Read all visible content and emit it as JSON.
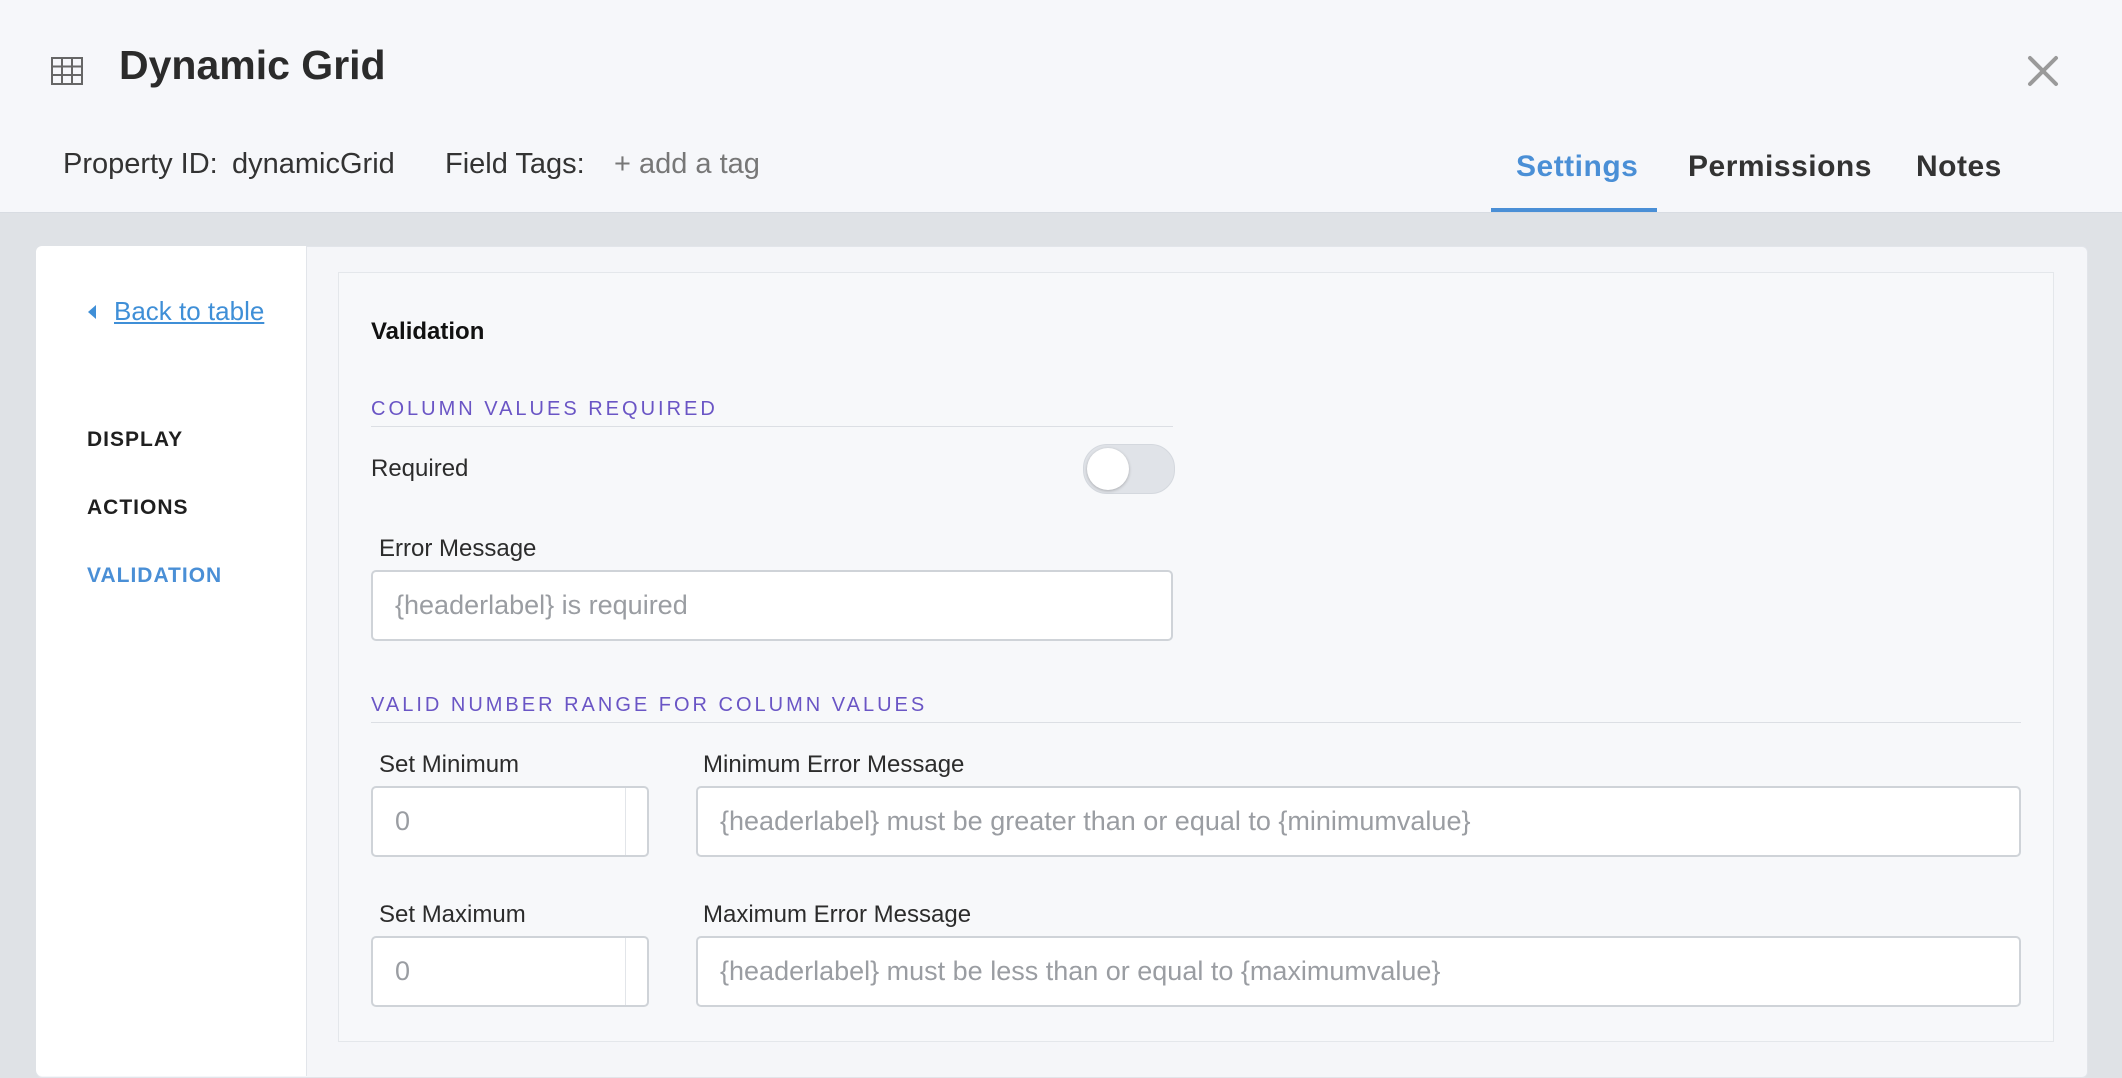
{
  "header": {
    "title": "Dynamic Grid",
    "property_id_label": "Property ID:",
    "property_id_value": "dynamicGrid",
    "field_tags_label": "Field Tags:",
    "add_tag_label": "+ add a tag"
  },
  "tabs": [
    {
      "label": "Settings",
      "active": true
    },
    {
      "label": "Permissions",
      "active": false
    },
    {
      "label": "Notes",
      "active": false
    }
  ],
  "sidebar": {
    "back_label": "Back to table",
    "items": [
      {
        "label": "DISPLAY",
        "active": false
      },
      {
        "label": "ACTIONS",
        "active": false
      },
      {
        "label": "VALIDATION",
        "active": true
      }
    ]
  },
  "validation": {
    "title": "Validation",
    "column_required": {
      "heading": "COLUMN VALUES REQUIRED",
      "required_label": "Required",
      "required_on": false,
      "error_label": "Error Message",
      "error_placeholder": "{headerlabel} is required"
    },
    "number_range": {
      "heading": "VALID NUMBER RANGE FOR COLUMN VALUES",
      "min_label": "Set Minimum",
      "min_placeholder": "0",
      "min_error_label": "Minimum Error Message",
      "min_error_placeholder": "{headerlabel} must be greater than or equal to {minimumvalue}",
      "max_label": "Set Maximum",
      "max_placeholder": "0",
      "max_error_label": "Maximum Error Message",
      "max_error_placeholder": "{headerlabel} must be less than or equal to {maximumvalue}"
    }
  },
  "colors": {
    "accent": "#4a8fd6",
    "section_heading": "#6a55c5"
  }
}
